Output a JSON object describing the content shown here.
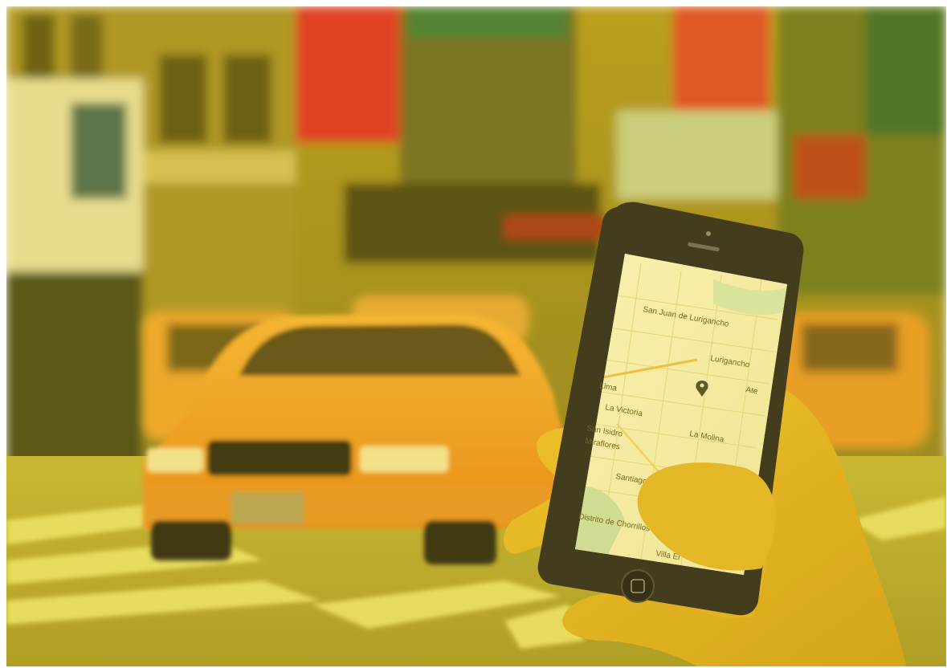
{
  "scene": {
    "filter_color": "#e6c300",
    "phone_screen": {
      "map_labels": [
        "San Juan de Lurigancho",
        "Lurigancho",
        "Lima",
        "La Victoria",
        "San Isidro",
        "Miraflores",
        "La Molina",
        "Santiago de Surco",
        "Distrito de Chorrillos",
        "Villa El",
        "Ate"
      ]
    },
    "icons": {
      "location_pin": "map-pin-icon",
      "home_button": "home-button-icon",
      "fab": "navigation-fab-icon"
    }
  }
}
